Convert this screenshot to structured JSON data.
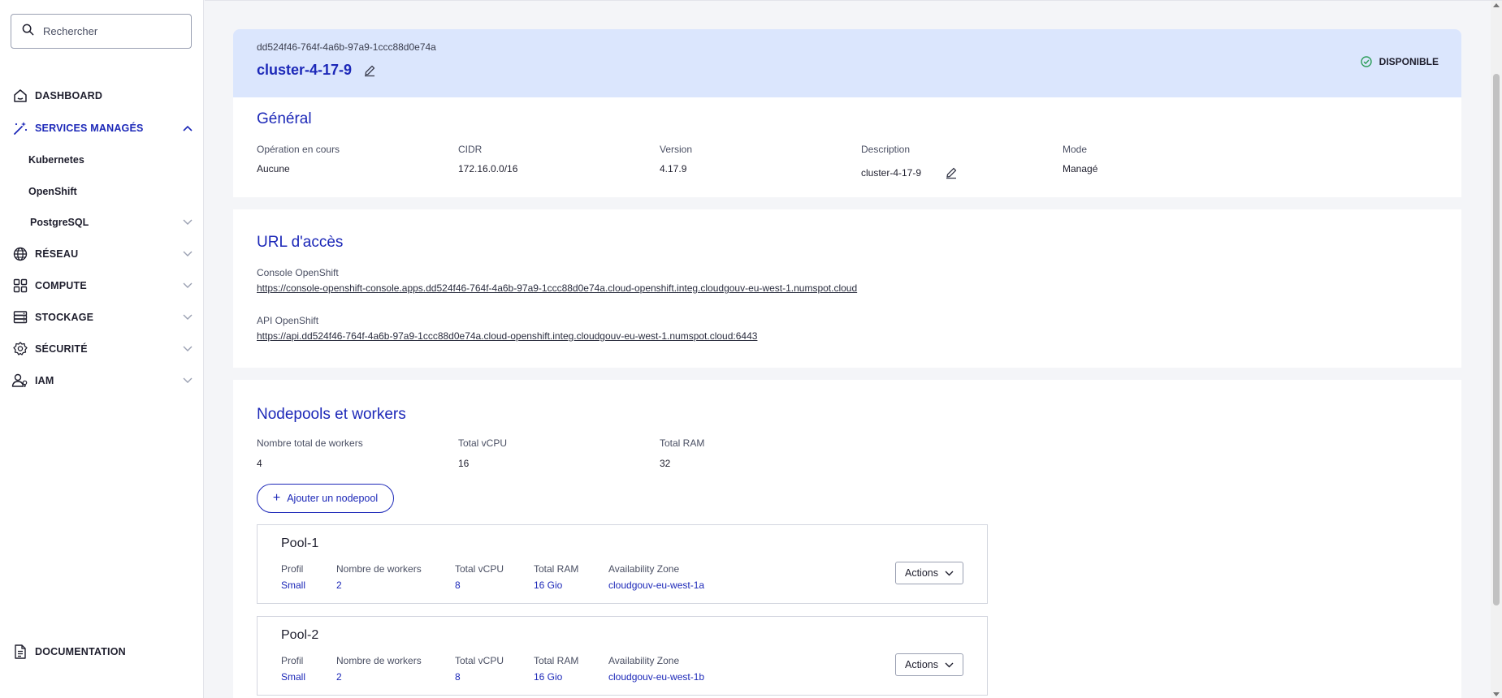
{
  "colors": {
    "accent": "#1c28b8",
    "header_bg": "#dbe6fd",
    "status_ok": "#2e9e5b"
  },
  "search": {
    "placeholder": "Rechercher",
    "icon": "search-icon"
  },
  "sidebar": {
    "items": [
      {
        "label": "DASHBOARD",
        "icon": "home-icon"
      },
      {
        "label": "SERVICES MANAGÉS",
        "icon": "magic-wand-icon",
        "expanded": true
      },
      {
        "label": "RÉSEAU",
        "icon": "globe-icon"
      },
      {
        "label": "COMPUTE",
        "icon": "grid-icon"
      },
      {
        "label": "STOCKAGE",
        "icon": "database-icon"
      },
      {
        "label": "SÉCURITÉ",
        "icon": "shield-icon"
      },
      {
        "label": "IAM",
        "icon": "users-icon"
      }
    ],
    "sub_items": [
      "Kubernetes",
      "OpenShift",
      "PostgreSQL"
    ],
    "footer": {
      "label": "DOCUMENTATION",
      "icon": "document-icon"
    }
  },
  "header": {
    "id": "dd524f46-764f-4a6b-97a9-1ccc88d0e74a",
    "title": "cluster-4-17-9",
    "status": "DISPONIBLE"
  },
  "general": {
    "title": "Général",
    "fields": [
      {
        "label": "Opération en cours",
        "value": "Aucune"
      },
      {
        "label": "CIDR",
        "value": "172.16.0.0/16"
      },
      {
        "label": "Version",
        "value": "4.17.9"
      },
      {
        "label": "Description",
        "value": "cluster-4-17-9"
      },
      {
        "label": "Mode",
        "value": "Managé"
      }
    ]
  },
  "urls": {
    "title": "URL d'accès",
    "items": [
      {
        "label": "Console OpenShift",
        "url": "https://console-openshift-console.apps.dd524f46-764f-4a6b-97a9-1ccc88d0e74a.cloud-openshift.integ.cloudgouv-eu-west-1.numspot.cloud"
      },
      {
        "label": "API OpenShift",
        "url": "https://api.dd524f46-764f-4a6b-97a9-1ccc88d0e74a.cloud-openshift.integ.cloudgouv-eu-west-1.numspot.cloud:6443"
      }
    ]
  },
  "nodepools": {
    "title": "Nodepools et workers",
    "summary": [
      {
        "label": "Nombre total de workers",
        "value": "4"
      },
      {
        "label": "Total vCPU",
        "value": "16"
      },
      {
        "label": "Total RAM",
        "value": "32"
      }
    ],
    "add_label": "Ajouter un nodepool",
    "column_labels": [
      "Profil",
      "Nombre de workers",
      "Total vCPU",
      "Total RAM",
      "Availability Zone"
    ],
    "actions_label": "Actions",
    "pools": [
      {
        "name": "Pool-1",
        "values": [
          "Small",
          "2",
          "8",
          "16 Gio",
          "cloudgouv-eu-west-1a"
        ]
      },
      {
        "name": "Pool-2",
        "values": [
          "Small",
          "2",
          "8",
          "16 Gio",
          "cloudgouv-eu-west-1b"
        ]
      }
    ]
  }
}
